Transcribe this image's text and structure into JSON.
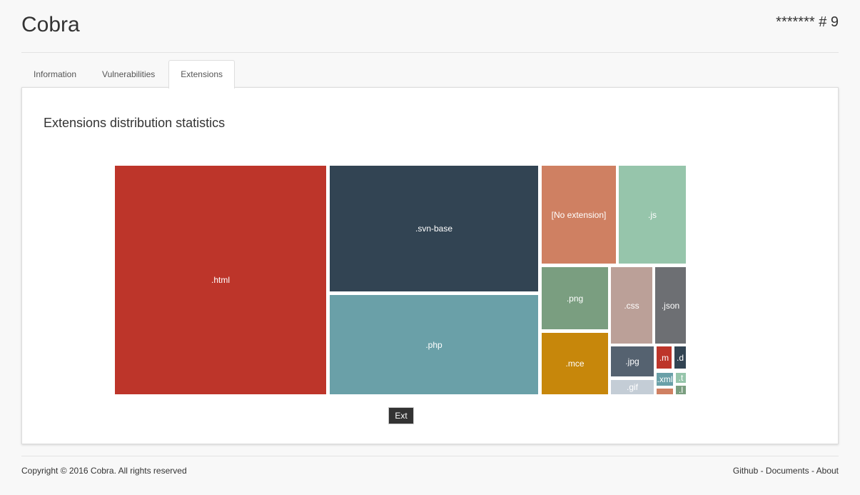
{
  "header": {
    "brand": "Cobra",
    "task_id": "******* # 9"
  },
  "tabs": [
    {
      "label": "Information",
      "active": false
    },
    {
      "label": "Vulnerabilities",
      "active": false
    },
    {
      "label": "Extensions",
      "active": true
    }
  ],
  "panel": {
    "title": "Extensions distribution statistics",
    "legend_label": "Ext"
  },
  "chart_data": {
    "type": "treemap",
    "colors": [
      "#bd352a",
      "#324453",
      "#6aa0a8",
      "#cf8062",
      "#96c5ab",
      "#7a9e80",
      "#c7870b",
      "#bba098",
      "#6d6f73",
      "#556270",
      "#c4cdd6"
    ],
    "items": [
      {
        "label": ".html",
        "color": "#bd352a"
      },
      {
        "label": ".svn-base",
        "color": "#324453"
      },
      {
        "label": ".php",
        "color": "#6aa0a8"
      },
      {
        "label": "[No extension]",
        "color": "#cf8062"
      },
      {
        "label": ".js",
        "color": "#96c5ab"
      },
      {
        "label": ".png",
        "color": "#7a9e80"
      },
      {
        "label": ".css",
        "color": "#bba098"
      },
      {
        "label": ".json",
        "color": "#6d6f73"
      },
      {
        "label": ".mce",
        "color": "#c7870b"
      },
      {
        "label": ".jpg",
        "color": "#556270"
      },
      {
        "label": ".m",
        "color": "#bd352a"
      },
      {
        "label": ".d",
        "color": "#324453"
      },
      {
        "label": ".gif",
        "color": "#c4cdd6"
      },
      {
        "label": ".xml",
        "color": "#6aa0a8"
      },
      {
        "label": ".t",
        "color": "#96c5ab"
      },
      {
        "label": "",
        "color": "#cf8062"
      },
      {
        "label": ".l",
        "color": "#7a9e80"
      }
    ]
  },
  "footer": {
    "copyright": "Copyright © 2016 Cobra. All rights reserved",
    "links": [
      "Github",
      "Documents",
      "About"
    ]
  }
}
